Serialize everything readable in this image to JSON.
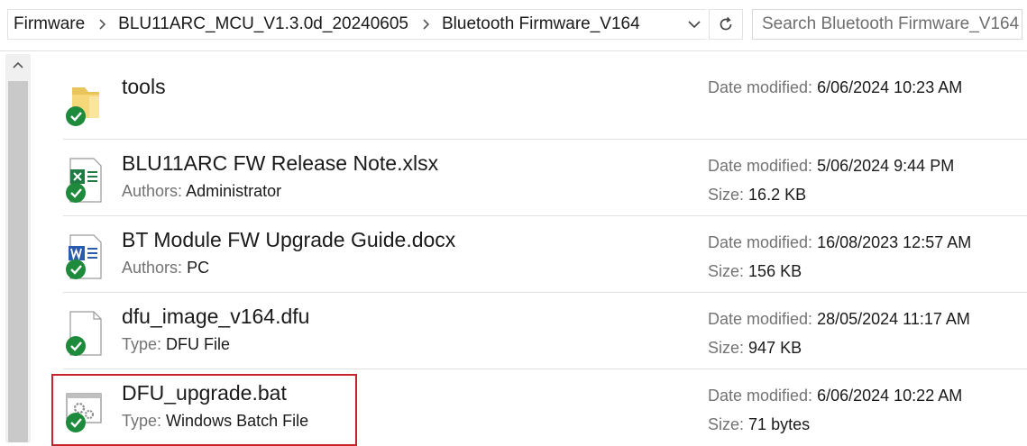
{
  "address": {
    "crumbs": [
      "Firmware",
      "BLU11ARC_MCU_V1.3.0d_20240605",
      "Bluetooth Firmware_V164"
    ],
    "search_placeholder": "Search Bluetooth Firmware_V164"
  },
  "files": [
    {
      "name": "tools",
      "icon": "folder-icon",
      "date_label": "Date modified:",
      "date": "6/06/2024 10:23 AM"
    },
    {
      "name": "BLU11ARC FW Release Note.xlsx",
      "icon": "excel-file-icon",
      "meta_label": "Authors:",
      "meta_value": "Administrator",
      "date_label": "Date modified:",
      "date": "5/06/2024 9:44 PM",
      "size_label": "Size:",
      "size": "16.2 KB"
    },
    {
      "name": "BT Module FW Upgrade Guide.docx",
      "icon": "word-file-icon",
      "meta_label": "Authors:",
      "meta_value": "PC",
      "date_label": "Date modified:",
      "date": "16/08/2023 12:57 AM",
      "size_label": "Size:",
      "size": "156 KB"
    },
    {
      "name": "dfu_image_v164.dfu",
      "icon": "generic-file-icon",
      "meta_label": "Type:",
      "meta_value": "DFU File",
      "date_label": "Date modified:",
      "date": "28/05/2024 11:17 AM",
      "size_label": "Size:",
      "size": "947 KB"
    },
    {
      "name": "DFU_upgrade.bat",
      "icon": "batch-file-icon",
      "meta_label": "Type:",
      "meta_value": "Windows Batch File",
      "date_label": "Date modified:",
      "date": "6/06/2024 10:22 AM",
      "size_label": "Size:",
      "size": "71 bytes"
    }
  ],
  "colors": {
    "sync_ok": "#1d8a3c",
    "highlight_border": "#c4242a",
    "excel": "#1f7a43",
    "word": "#2b5cab"
  }
}
